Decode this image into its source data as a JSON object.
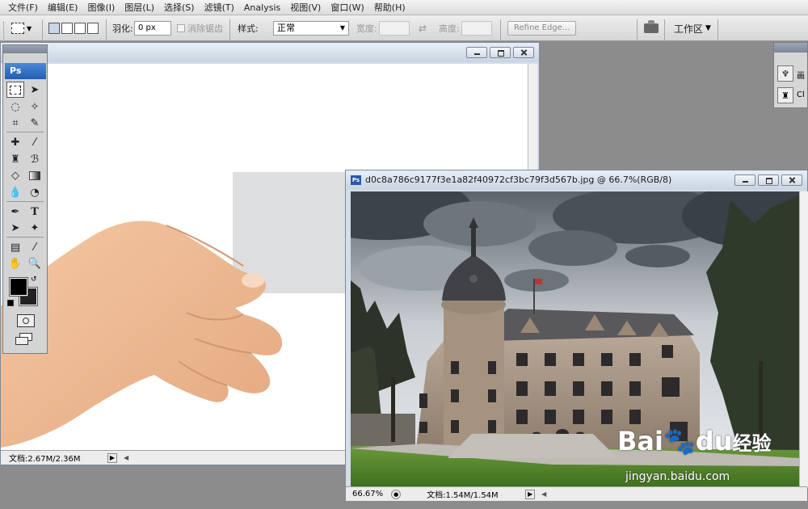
{
  "menu": [
    "文件(F)",
    "编辑(E)",
    "图像(I)",
    "图层(L)",
    "选择(S)",
    "滤镜(T)",
    "Analysis",
    "视图(V)",
    "窗口(W)",
    "帮助(H)"
  ],
  "options": {
    "feather_label": "羽化:",
    "feather_value": "0 px",
    "antialias_label": "消除锯齿",
    "style_label": "样式:",
    "style_value": "正常",
    "width_label": "宽度:",
    "height_label": "高度:",
    "refine_edge": "Refine Edge...",
    "workspace": "工作区"
  },
  "toolbox": {
    "logo": "Ps",
    "text_tool": "T"
  },
  "doc1": {
    "status": "文档:2.67M/2.36M"
  },
  "doc2": {
    "title": "d0c8a786c9177f3e1a82f40972cf3bc79f3d567b.jpg @ 66.7%(RGB/8)",
    "zoom": "66.67%",
    "status": "文档:1.54M/1.54M",
    "doc_icon": "Ps"
  },
  "right_panel": {
    "item1": "画",
    "item2": "Cl"
  },
  "watermark": {
    "brand": "Bai",
    "brand2": "du",
    "cn": "经验",
    "url": "jingyan.baidu.com"
  }
}
